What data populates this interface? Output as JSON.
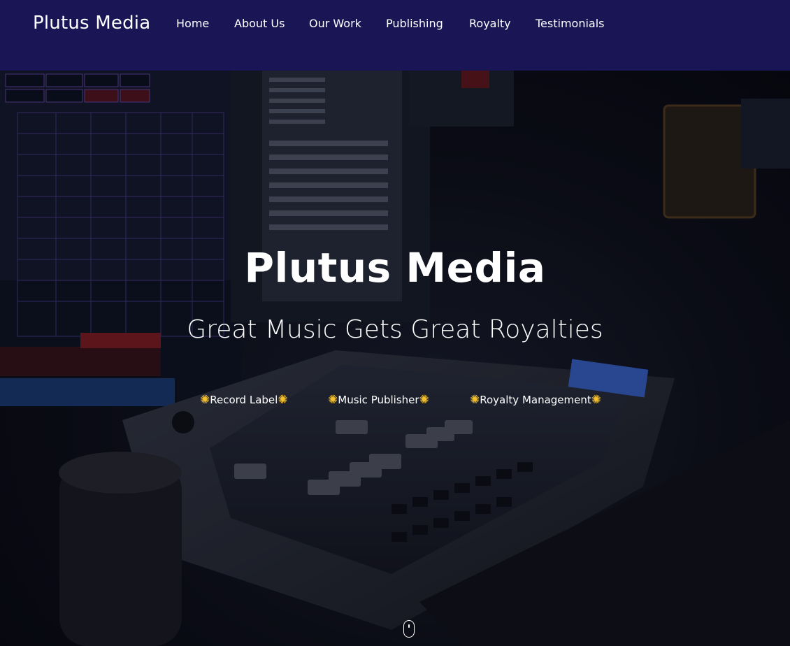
{
  "navbar": {
    "brand": "Plutus Media",
    "links": [
      "Home",
      "About Us",
      "Our Work",
      "Publishing",
      "Royalty",
      "Testimonials"
    ]
  },
  "hero": {
    "title": "Plutus Media",
    "subtitle": "Great Music Gets Great Royalties",
    "services": [
      "Record Label",
      "Music Publisher",
      "Royalty Management"
    ],
    "service_icon": "sun-icon",
    "scroll_icon": "mouse-scroll-icon"
  },
  "colors": {
    "navbar_bg": "#1a1656",
    "accent_sun": "#f5c12e",
    "text": "#ffffff"
  }
}
